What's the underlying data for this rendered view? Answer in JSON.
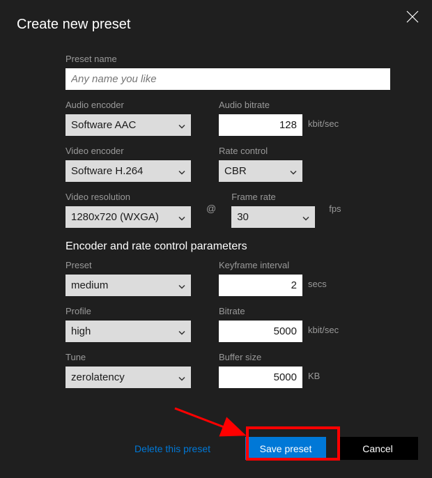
{
  "title": "Create new preset",
  "preset_name": {
    "label": "Preset name",
    "placeholder": "Any name you like"
  },
  "audio_encoder": {
    "label": "Audio encoder",
    "value": "Software AAC"
  },
  "audio_bitrate": {
    "label": "Audio bitrate",
    "value": "128",
    "unit": "kbit/sec"
  },
  "video_encoder": {
    "label": "Video encoder",
    "value": "Software H.264"
  },
  "rate_control": {
    "label": "Rate control",
    "value": "CBR"
  },
  "video_resolution": {
    "label": "Video resolution",
    "value": "1280x720 (WXGA)"
  },
  "at_symbol": "@",
  "frame_rate": {
    "label": "Frame rate",
    "value": "30",
    "unit": "fps"
  },
  "section_heading": "Encoder and rate control parameters",
  "preset": {
    "label": "Preset",
    "value": "medium"
  },
  "keyframe": {
    "label": "Keyframe interval",
    "value": "2",
    "unit": "secs"
  },
  "profile": {
    "label": "Profile",
    "value": "high"
  },
  "bitrate": {
    "label": "Bitrate",
    "value": "5000",
    "unit": "kbit/sec"
  },
  "tune": {
    "label": "Tune",
    "value": "zerolatency"
  },
  "buffer": {
    "label": "Buffer size",
    "value": "5000",
    "unit": "KB"
  },
  "footer": {
    "delete": "Delete this preset",
    "save": "Save preset",
    "cancel": "Cancel"
  }
}
